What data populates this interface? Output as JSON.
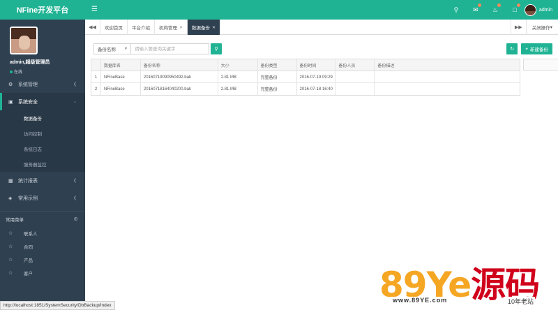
{
  "header": {
    "brand": "NFine开发平台",
    "menu_icon": "hamburger-icon",
    "username": "admin"
  },
  "sidebar": {
    "profile_name": "admin,超级管理员",
    "profile_status": "在线",
    "items": [
      {
        "label": "系统管理",
        "icon": "gear-icon"
      },
      {
        "label": "系统安全",
        "icon": "monitor-icon",
        "open": true
      },
      {
        "label": "统计报表",
        "icon": "chart-icon"
      },
      {
        "label": "常用示例",
        "icon": "tag-icon"
      }
    ],
    "subitems": [
      "数据备份",
      "访问控制",
      "系统日志",
      "服务器监控"
    ],
    "favorites_title": "常用菜单",
    "favorites": [
      "联系人",
      "合同",
      "产品",
      "客户"
    ]
  },
  "tabs": {
    "items": [
      {
        "label": "欢迎首页",
        "closable": false
      },
      {
        "label": "平台介绍",
        "closable": false
      },
      {
        "label": "机构管理",
        "closable": true
      },
      {
        "label": "数据备份",
        "closable": true,
        "active": true
      }
    ],
    "close_ops": "关闭操作"
  },
  "toolbar": {
    "select_value": "备份名称",
    "search_placeholder": "请输入要查询关键字",
    "backup_label": "新建备份"
  },
  "grid": {
    "columns": [
      "数据库名",
      "备份名称",
      "大小",
      "备份类型",
      "备份时间",
      "备份人员",
      "备份描述"
    ],
    "rows": [
      {
        "idx": "1",
        "db": "NFineBase",
        "name": "20160719090950492.bak",
        "size": "2.81 MB",
        "type": "完整备份",
        "time": "2016-07-19 09:29",
        "user": "",
        "desc": ""
      },
      {
        "idx": "2",
        "db": "NFineBase",
        "name": "20160718164040200.bak",
        "size": "2.81 MB",
        "type": "完整备份",
        "time": "2016-07-18 16:40",
        "user": "",
        "desc": ""
      }
    ]
  },
  "statusbar": "http://localhost:1851/SystemSecurity/DbBackup/Index",
  "watermark": {
    "part1": "89Ye",
    "part2": "源码",
    "url": "www.89YE.com",
    "tag": "10年老站"
  },
  "colors": {
    "accent": "#1fb394",
    "sidebar": "#2f4050"
  }
}
